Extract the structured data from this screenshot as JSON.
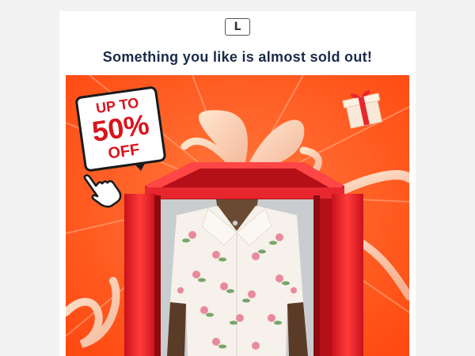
{
  "brand": {
    "logo_letter": "L"
  },
  "email": {
    "headline": "Something you like is almost sold out!"
  },
  "banner": {
    "badge": {
      "line1": "UP TO",
      "line2": "50%",
      "line3": "OFF"
    }
  },
  "icons": {
    "hand_cursor": "hand-pointer-icon",
    "gift": "gift-icon"
  },
  "colors": {
    "banner_bg": "#ff5a1f",
    "gift_box": "#e8262e",
    "badge_text": "#d9141c",
    "headline": "#1b2a4a"
  }
}
